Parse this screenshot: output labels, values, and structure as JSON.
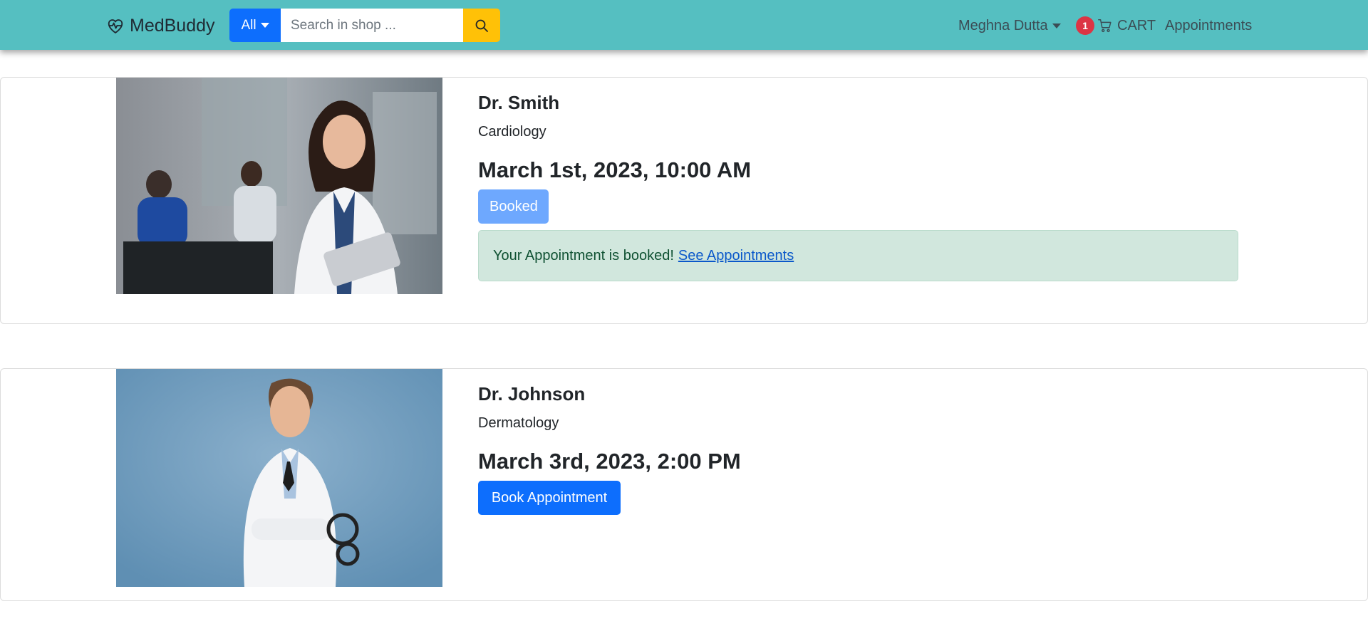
{
  "navbar": {
    "brand": "MedBuddy",
    "category_label": "All",
    "search_placeholder": "Search in shop ...",
    "user_name": "Meghna Dutta",
    "cart_count": "1",
    "cart_label": "CART",
    "appointments_label": "Appointments"
  },
  "doctors": [
    {
      "name": "Dr. Smith",
      "specialty": "Cardiology",
      "datetime": "March 1st, 2023, 10:00 AM",
      "button_label": "Booked",
      "alert_text": "Your Appointment is booked!",
      "alert_link": "See Appointments"
    },
    {
      "name": "Dr. Johnson",
      "specialty": "Dermatology",
      "datetime": "March 3rd, 2023, 2:00 PM",
      "button_label": "Book Appointment"
    }
  ],
  "colors": {
    "navbar": "#55bfc1",
    "primary": "#0d6efd",
    "booked": "#6ea8fe",
    "search_button": "#ffc107",
    "badge": "#dc3545",
    "alert_bg": "#d1e7dd"
  }
}
